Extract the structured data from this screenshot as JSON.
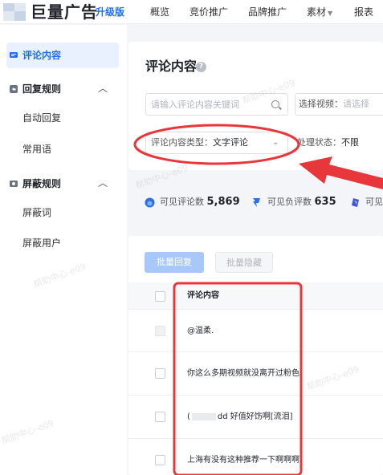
{
  "header": {
    "brand": "巨量广告",
    "badge": "升级版",
    "nav": [
      {
        "label": "概览"
      },
      {
        "label": "竞价推广"
      },
      {
        "label": "品牌推广"
      },
      {
        "label": "素材"
      },
      {
        "label": "报表"
      }
    ]
  },
  "sidebar": {
    "items": [
      {
        "label": "评论内容",
        "active": true
      },
      {
        "label": "回复规则",
        "expanded": true
      },
      {
        "label": "自动回复"
      },
      {
        "label": "常用语"
      },
      {
        "label": "屏蔽规则",
        "expanded": true
      },
      {
        "label": "屏蔽词"
      },
      {
        "label": "屏蔽用户"
      }
    ]
  },
  "main": {
    "title": "评论内容",
    "search_placeholder": "请输入评论内容关键词",
    "video_filter": {
      "label": "选择视频：",
      "placeholder": "请选择"
    },
    "type_filter": {
      "label": "评论内容类型：",
      "value": "文字评论"
    },
    "status_filter": {
      "label": "处理状态：",
      "value": "不限"
    },
    "stats": [
      {
        "label": "可见评论数",
        "value": "5,869"
      },
      {
        "label": "可见负评数",
        "value": "635"
      },
      {
        "label": "可见"
      }
    ],
    "actions": {
      "batch_reply": "批量回复",
      "batch_hide": "批量隐藏"
    },
    "table": {
      "header": "评论内容",
      "rows": [
        {
          "pre": "@温柔.",
          "post": ""
        },
        {
          "pre": "你这么多期视频就没离开过粉色",
          "post": ""
        },
        {
          "pre": "(",
          "post": "dd 好值好饬啊[流泪]"
        },
        {
          "pre": "上海有没有这种推荐一下啊啊啊",
          "post": ""
        }
      ]
    }
  },
  "watermark_text": "帮助中心-e09",
  "colors": {
    "accent": "#1d6ff5",
    "annotation": "#e8373a",
    "disabled_btn": "#a9c8fa"
  }
}
